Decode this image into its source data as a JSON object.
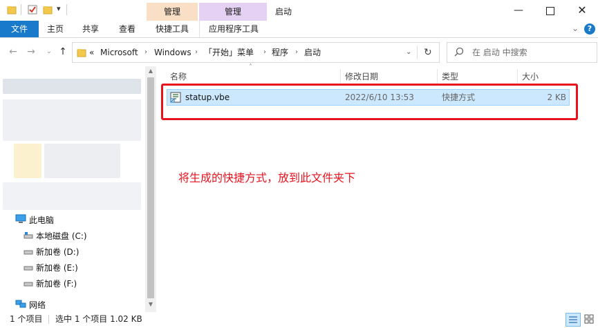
{
  "title_bar": {
    "window_title": "启动",
    "context_tab_1": "管理",
    "context_tab_2": "管理",
    "context_color_1": "#f9dfc5",
    "context_color_2": "#e5d1f3",
    "quick_access_icons": [
      "folder-icon",
      "checkbox-icon",
      "folder-icon",
      "dropdown-icon"
    ]
  },
  "ribbon": {
    "tabs": [
      "文件",
      "主页",
      "共享",
      "查看",
      "快捷工具",
      "应用程序工具"
    ],
    "file_tab_color": "#1979ca"
  },
  "address": {
    "overflow": "«",
    "crumbs": [
      "Microsoft",
      "Windows",
      "「开始」菜单",
      "程序",
      "启动"
    ]
  },
  "search": {
    "placeholder": "在 启动 中搜索"
  },
  "columns": {
    "name": "名称",
    "date": "修改日期",
    "type": "类型",
    "size": "大小"
  },
  "file": {
    "name": "statup.vbe",
    "date": "2022/6/10 13:53",
    "type": "快捷方式",
    "size": "2 KB"
  },
  "annotation": {
    "text": "将生成的快捷方式，放到此文件夹下",
    "color": "#e8121f"
  },
  "nav": {
    "this_pc": "此电脑",
    "drives": [
      "本地磁盘 (C:)",
      "新加卷 (D:)",
      "新加卷 (E:)",
      "新加卷 (F:)"
    ],
    "network": "网络"
  },
  "status": {
    "count": "1 个项目",
    "selected": "选中 1 个项目  1.02 KB"
  }
}
